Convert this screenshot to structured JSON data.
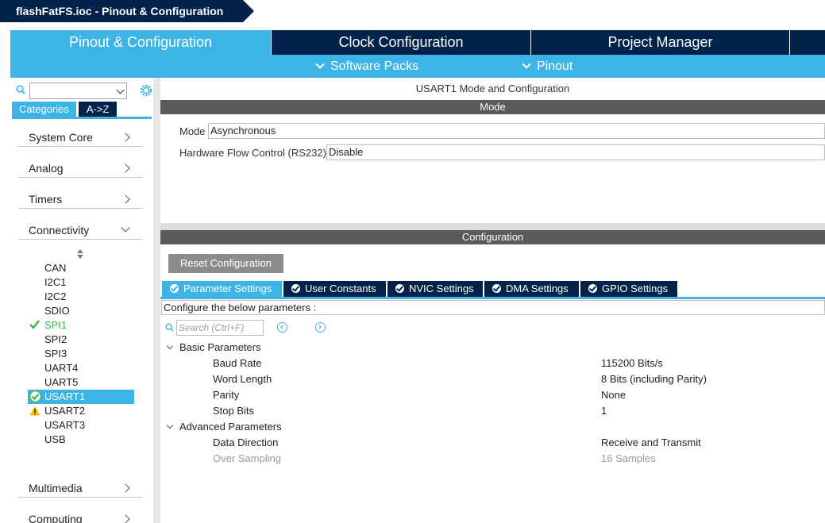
{
  "breadcrumb": {
    "file": "flashFatFS.ioc - Pinout & Configuration"
  },
  "top_tabs": [
    {
      "label": "Pinout & Configuration",
      "active": true
    },
    {
      "label": "Clock Configuration",
      "active": false
    },
    {
      "label": "Project Manager",
      "active": false
    },
    {
      "label": "",
      "active": false
    }
  ],
  "sub_menu": {
    "software_packs": "Software Packs",
    "pinout": "Pinout"
  },
  "left": {
    "search": {
      "value": ""
    },
    "view_tabs": {
      "categories": "Categories",
      "az": "A->Z"
    },
    "categories": [
      {
        "label": "System Core"
      },
      {
        "label": "Analog"
      },
      {
        "label": "Timers"
      },
      {
        "label": "Connectivity",
        "expanded": true
      },
      {
        "label": "Multimedia"
      },
      {
        "label": "Computing"
      }
    ],
    "peripherals": [
      {
        "label": "CAN",
        "status": "none"
      },
      {
        "label": "I2C1",
        "status": "none"
      },
      {
        "label": "I2C2",
        "status": "none"
      },
      {
        "label": "SDIO",
        "status": "none"
      },
      {
        "label": "SPI1",
        "status": "ok"
      },
      {
        "label": "SPI2",
        "status": "none"
      },
      {
        "label": "SPI3",
        "status": "none"
      },
      {
        "label": "UART4",
        "status": "none"
      },
      {
        "label": "UART5",
        "status": "none"
      },
      {
        "label": "USART1",
        "status": "ok-selected"
      },
      {
        "label": "USART2",
        "status": "warning"
      },
      {
        "label": "USART3",
        "status": "none"
      },
      {
        "label": "USB",
        "status": "none"
      }
    ]
  },
  "right": {
    "title": "USART1 Mode and Configuration",
    "mode_header": "Mode",
    "mode_field": {
      "label": "Mode",
      "value": "Asynchronous"
    },
    "flow_field": {
      "label": "Hardware Flow Control (RS232)",
      "value": "Disable"
    },
    "config_header": "Configuration",
    "reset_button": "Reset Configuration",
    "config_tabs": [
      {
        "label": "Parameter Settings",
        "active": true
      },
      {
        "label": "User Constants",
        "active": false
      },
      {
        "label": "NVIC Settings",
        "active": false
      },
      {
        "label": "DMA Settings",
        "active": false
      },
      {
        "label": "GPIO Settings",
        "active": false
      }
    ],
    "configure_text": "Configure the below parameters :",
    "search_placeholder": "Search (Ctrl+F)",
    "groups": {
      "basic": {
        "label": "Basic Parameters",
        "params": [
          {
            "name": "Baud Rate",
            "value": "115200 Bits/s"
          },
          {
            "name": "Word Length",
            "value": "8 Bits (including Parity)"
          },
          {
            "name": "Parity",
            "value": "None"
          },
          {
            "name": "Stop Bits",
            "value": "1"
          }
        ]
      },
      "advanced": {
        "label": "Advanced Parameters",
        "params": [
          {
            "name": "Data Direction",
            "value": "Receive and Transmit"
          },
          {
            "name": "Over Sampling",
            "value": "16 Samples"
          }
        ]
      }
    }
  },
  "colors": {
    "navy": "#03234b",
    "accent": "#3cb4e6",
    "ok": "#3ab54a",
    "warning": "#f5c400"
  }
}
